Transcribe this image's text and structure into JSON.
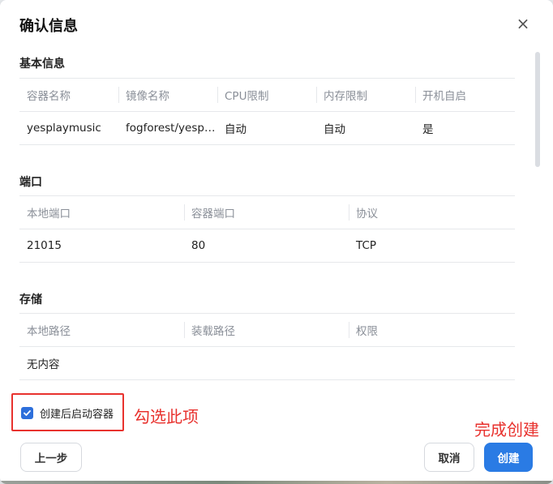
{
  "dialog": {
    "title": "确认信息",
    "close_glyph": "×"
  },
  "basic": {
    "title": "基本信息",
    "headers": [
      "容器名称",
      "镜像名称",
      "CPU限制",
      "内存限制",
      "开机自启"
    ],
    "row": [
      "yesplaymusic",
      "fogforest/yespl...",
      "自动",
      "自动",
      "是"
    ]
  },
  "ports": {
    "title": "端口",
    "headers": [
      "本地端口",
      "容器端口",
      "协议"
    ],
    "row": [
      "21015",
      "80",
      "TCP"
    ]
  },
  "storage": {
    "title": "存储",
    "headers": [
      "本地路径",
      "装载路径",
      "权限"
    ],
    "empty_text": "无内容"
  },
  "checkbox": {
    "label": "创建后启动容器",
    "checked": true
  },
  "annotations": {
    "check_hint": "勾选此项",
    "create_hint": "完成创建",
    "color": "#e8322e"
  },
  "buttons": {
    "prev": "上一步",
    "cancel": "取消",
    "create": "创建"
  },
  "colors": {
    "primary": "#2a7be4"
  }
}
